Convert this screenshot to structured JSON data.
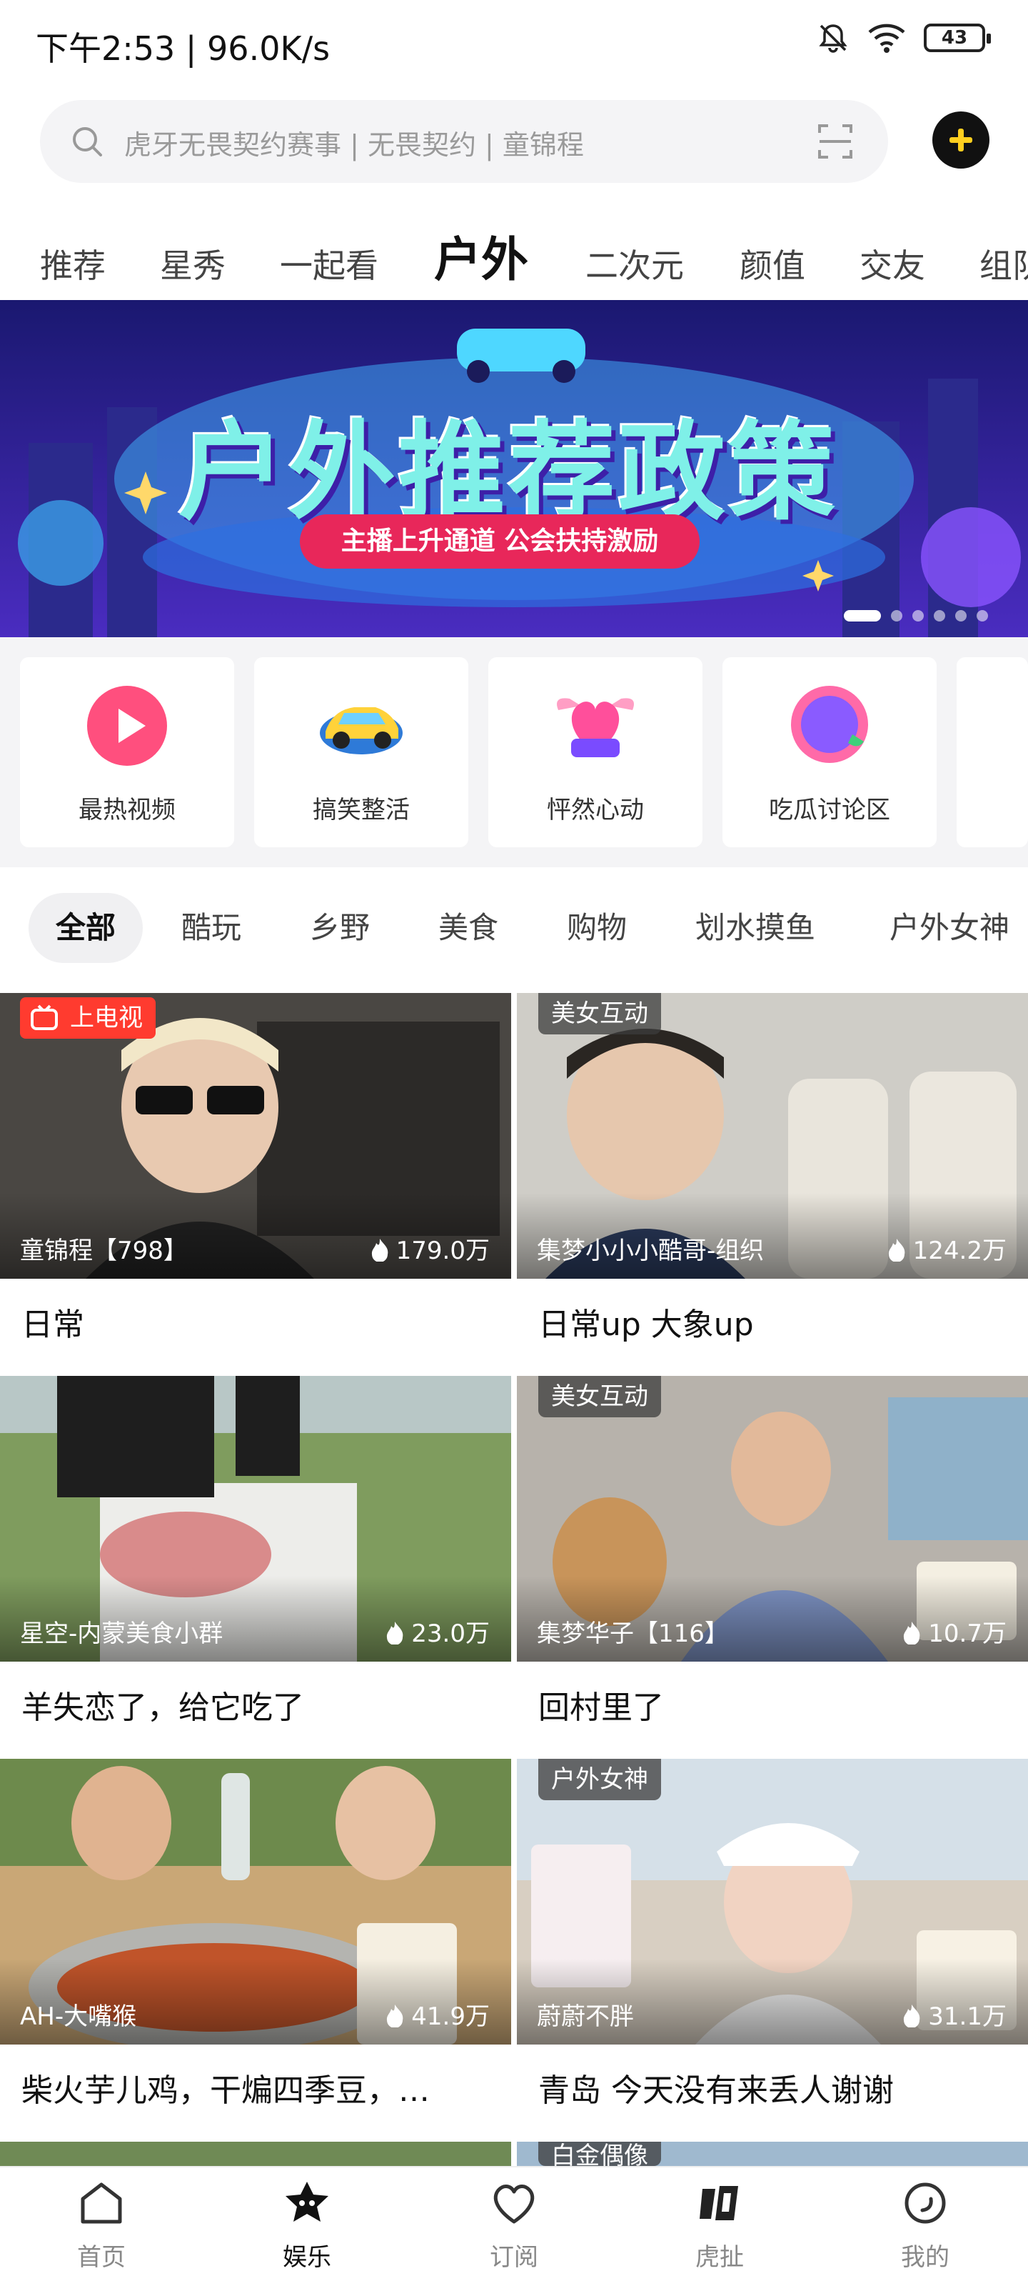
{
  "status": {
    "time_speed": "下午2:53 | 96.0K/s",
    "battery": "43"
  },
  "search": {
    "placeholder": "虎牙无畏契约赛事 | 无畏契约 | 童锦程"
  },
  "top_tabs": [
    "推荐",
    "星秀",
    "一起看",
    "户外",
    "二次元",
    "颜值",
    "交友",
    "组队"
  ],
  "active_top_tab": "户外",
  "banner": {
    "title": "户外推荐政策",
    "subtitle": "主播上升通道 公会扶持激励",
    "dot_count": 6,
    "active_dot": 0
  },
  "quick_items": [
    {
      "label": "最热视频",
      "icon": "play-icon"
    },
    {
      "label": "搞笑整活",
      "icon": "car-icon"
    },
    {
      "label": "怦然心动",
      "icon": "heart-icon"
    },
    {
      "label": "吃瓜讨论区",
      "icon": "gossip-icon"
    }
  ],
  "sub_tabs": [
    "全部",
    "酷玩",
    "乡野",
    "美食",
    "购物",
    "划水摸鱼",
    "户外女神"
  ],
  "active_sub_tab": "全部",
  "cards": [
    {
      "badge": "上电视",
      "badge_type": "tv",
      "streamer": "童锦程【798】",
      "viewers": "179.0万",
      "title": "日常",
      "bg": "#3d3a36"
    },
    {
      "badge": "美女互动",
      "badge_type": "normal",
      "streamer": "集梦小小小酷哥-组织",
      "viewers": "124.2万",
      "title": "日常up 大象up",
      "bg": "#b9b8b3"
    },
    {
      "badge": "",
      "badge_type": "none",
      "streamer": "星空-内蒙美食小群",
      "viewers": "23.0万",
      "title": "羊失恋了，给它吃了",
      "bg": "#6f8a55"
    },
    {
      "badge": "美女互动",
      "badge_type": "normal",
      "streamer": "集梦华子【116】",
      "viewers": "10.7万",
      "title": "回村里了",
      "bg": "#a7a4a0"
    },
    {
      "badge": "",
      "badge_type": "none",
      "streamer": "AH-大嘴猴",
      "viewers": "41.9万",
      "title": "柴火芋儿鸡，干煸四季豆，…",
      "bg": "#7a5a3e"
    },
    {
      "badge": "户外女神",
      "badge_type": "normal",
      "streamer": "蔚蔚不胖",
      "viewers": "31.1万",
      "title": "青岛 今天没有来丢人谢谢",
      "bg": "#c9d6df"
    }
  ],
  "partial_card_badge": "白金偶像",
  "bottom_nav": [
    {
      "label": "首页",
      "icon": "home-icon"
    },
    {
      "label": "娱乐",
      "icon": "entertainment-icon"
    },
    {
      "label": "订阅",
      "icon": "subscribe-heart-icon"
    },
    {
      "label": "虎扯",
      "icon": "huche-icon"
    },
    {
      "label": "我的",
      "icon": "profile-icon"
    }
  ],
  "active_nav": "娱乐",
  "colors": {
    "accent_yellow": "#ffcf1f",
    "tv_badge_red": "#ff3b2f",
    "banner_bg": "#2a1f8a"
  }
}
